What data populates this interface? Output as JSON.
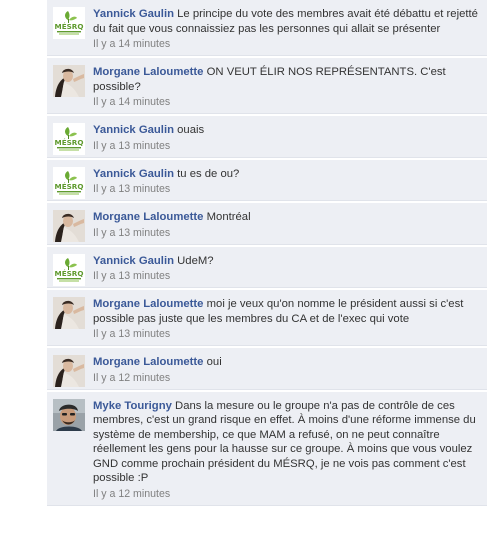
{
  "comments": [
    {
      "author": "Yannick Gaulin",
      "avatar": "mesrq-logo",
      "text": "Le principe du vote des membres avait été débattu et rejetté du fait que vous connaissiez pas les personnes qui allait se présenter",
      "time": "Il y a 14 minutes"
    },
    {
      "author": "Morgane Laloumette",
      "avatar": "woman-photo",
      "text": "ON VEUT ÉLIR NOS REPRÉSENTANTS. C'est possible?",
      "time": "Il y a 14 minutes"
    },
    {
      "author": "Yannick Gaulin",
      "avatar": "mesrq-logo",
      "text": "ouais",
      "time": "Il y a 13 minutes"
    },
    {
      "author": "Yannick Gaulin",
      "avatar": "mesrq-logo",
      "text": "tu es de ou?",
      "time": "Il y a 13 minutes"
    },
    {
      "author": "Morgane Laloumette",
      "avatar": "woman-photo",
      "text": "Montréal",
      "time": "Il y a 13 minutes"
    },
    {
      "author": "Yannick Gaulin",
      "avatar": "mesrq-logo",
      "text": "UdeM?",
      "time": "Il y a 13 minutes"
    },
    {
      "author": "Morgane Laloumette",
      "avatar": "woman-photo",
      "text": "moi je veux qu'on nomme le président aussi si c'est possible pas juste que les membres du CA et de l'exec qui vote",
      "time": "Il y a 13 minutes"
    },
    {
      "author": "Morgane Laloumette",
      "avatar": "woman-photo",
      "text": "oui",
      "time": "Il y a 12 minutes"
    },
    {
      "author": "Myke Tourigny",
      "avatar": "man-photo",
      "text": "Dans la mesure ou le groupe n'a pas de contrôle de ces membres, c'est un grand risque en effet. À moins d'une réforme immense du système de membership, ce que MAM a refusé, on ne peut connaître réellement les gens pour la hausse sur ce groupe. À moins que vous voulez GND comme prochain président du MÉSRQ, je ne vois pas comment c'est possible :P",
      "time": "Il y a 12 minutes"
    }
  ],
  "logo_text": "MÉSRQ",
  "colors": {
    "author": "#3b5998",
    "background": "#edeff4",
    "time": "#808080",
    "logo_green": "#5f9a2e"
  }
}
